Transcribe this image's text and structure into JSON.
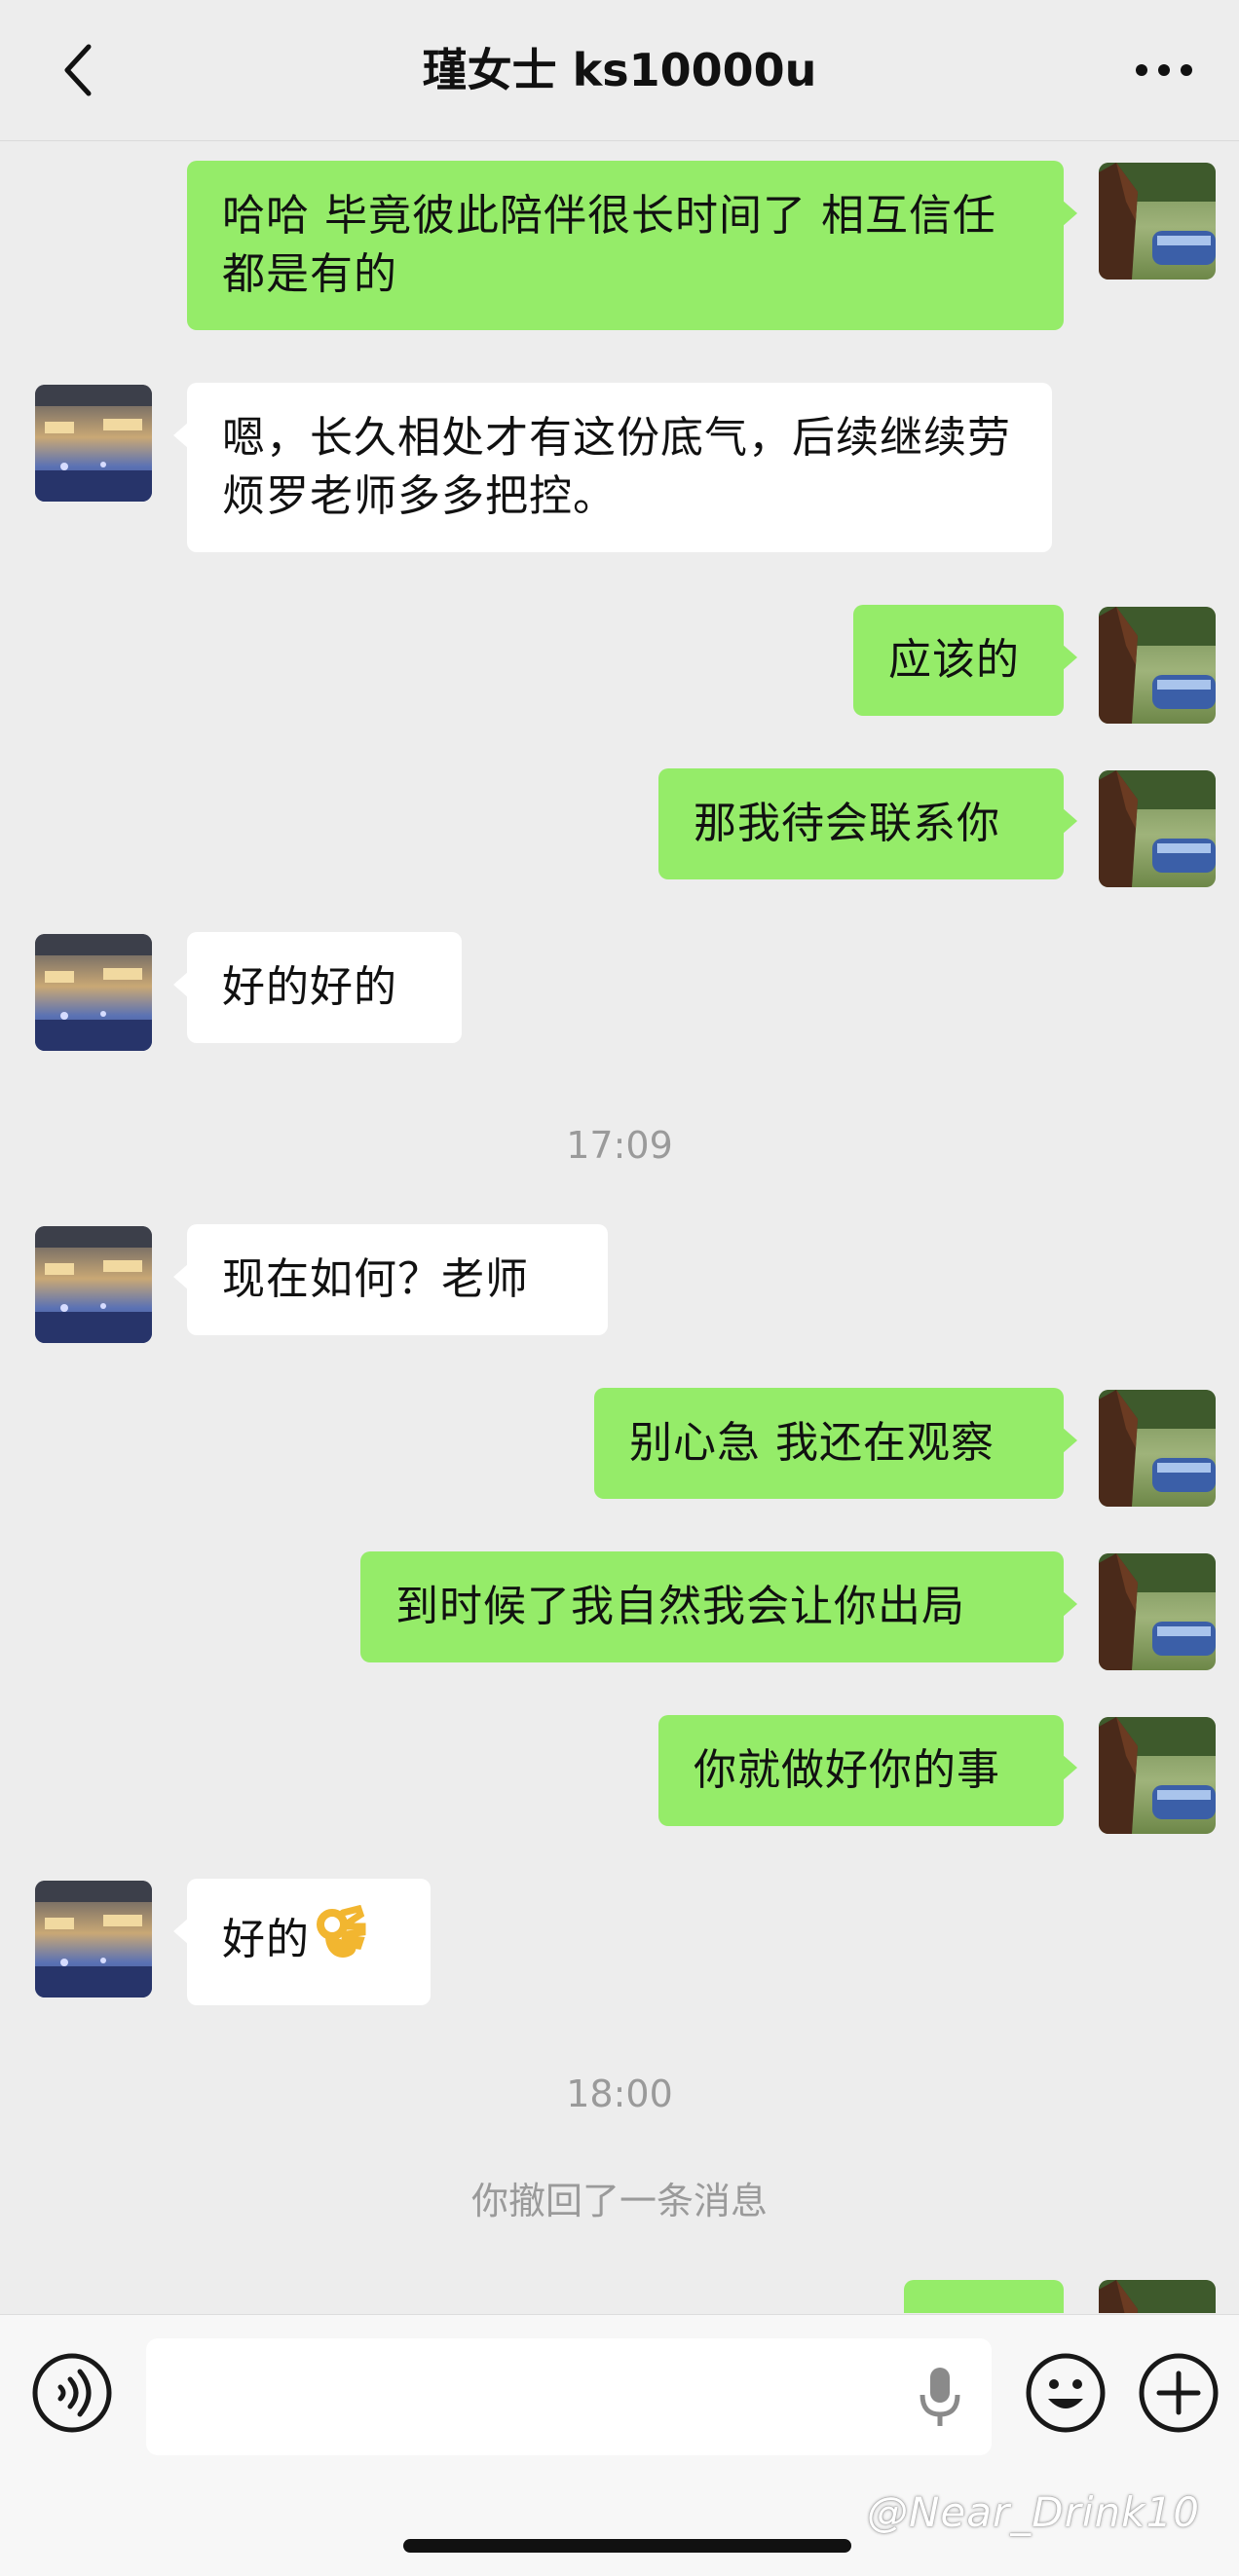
{
  "header": {
    "title": "瑾女士 ks10000u",
    "back_icon": "chevron-left-icon",
    "more_icon": "more-dots-icon"
  },
  "messages": [
    {
      "side": "me",
      "text": "哈哈 毕竟彼此陪伴很长时间了 相互信任都是有的"
    },
    {
      "side": "them",
      "text": "嗯，长久相处才有这份底气，后续继续劳烦罗老师多多把控。"
    },
    {
      "side": "me",
      "text": "应该的"
    },
    {
      "side": "me",
      "text": "那我待会联系你"
    },
    {
      "side": "them",
      "text": "好的好的"
    },
    {
      "side": "time",
      "text": "17:09"
    },
    {
      "side": "them",
      "text": "现在如何？老师"
    },
    {
      "side": "me",
      "text": "别心急 我还在观察"
    },
    {
      "side": "me",
      "text": "到时候了我自然我会让你出局"
    },
    {
      "side": "me",
      "text": "你就做好你的事"
    },
    {
      "side": "them",
      "text": "好的",
      "emoji": "ok-hand-emoji"
    },
    {
      "side": "time",
      "text": "18:00"
    },
    {
      "side": "system",
      "text": "你撤回了一条消息"
    }
  ],
  "input": {
    "value": "",
    "voice_icon": "voice-icon",
    "mic_icon": "microphone-icon",
    "emoji_icon": "emoji-face-icon",
    "plus_icon": "plus-icon"
  },
  "watermark": "@Near_Drink10",
  "colors": {
    "my_bubble": "#95ec69",
    "their_bubble": "#ffffff",
    "background": "#ededed"
  }
}
